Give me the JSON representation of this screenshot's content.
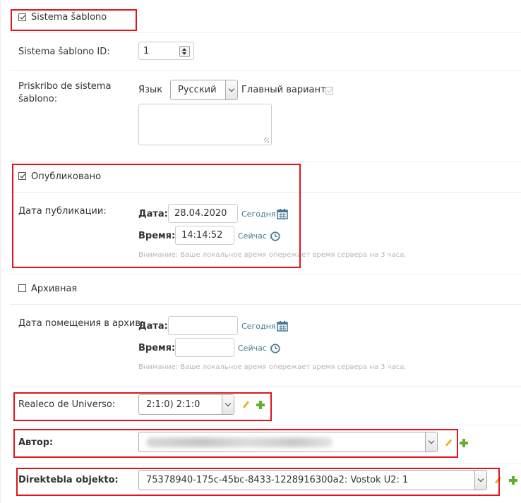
{
  "template_section": {
    "checkbox_label": "Sistema šablono",
    "id_label": "Sistema šablono ID:",
    "id_value": "1",
    "description_label_line1": "Priskribo de sistema",
    "description_label_line2": "šablono:",
    "language_label": "Язык",
    "language_value": "Русский",
    "main_variant_label": "Главный вариант"
  },
  "published_section": {
    "checkbox_label": "Опубликовано",
    "date_label": "Дата публикации:",
    "date_field_label": "Дата:",
    "date_value": "28.04.2020",
    "today_link": "Сегодня",
    "time_field_label": "Время:",
    "time_value": "14:14:52",
    "now_link": "Сейчас",
    "timezone_note": "Внимание: Ваше локальное время опережает время сервера на 3 часа."
  },
  "archive_section": {
    "checkbox_label": "Архивная",
    "date_label": "Дата помещения в архив:",
    "date_field_label": "Дата:",
    "today_link": "Сегодня",
    "time_field_label": "Время:",
    "now_link": "Сейчас",
    "timezone_note": "Внимание: Ваше локальное время опережает время сервера на 3 часа."
  },
  "universe": {
    "label": "Realeco de Universo:",
    "value": "2:1:0) 2:1:0"
  },
  "author": {
    "label": "Автор:"
  },
  "direct_object": {
    "label": "Direktebla objekto:",
    "value": "75378940-175c-45bc-8433-1228916300a2: Vostok U2: 1"
  },
  "separator": "|",
  "colors": {
    "link": "#417690",
    "highlight_border": "#e0141e",
    "add_icon": "#5fae2c",
    "edit_icon": "#e9b22c"
  }
}
